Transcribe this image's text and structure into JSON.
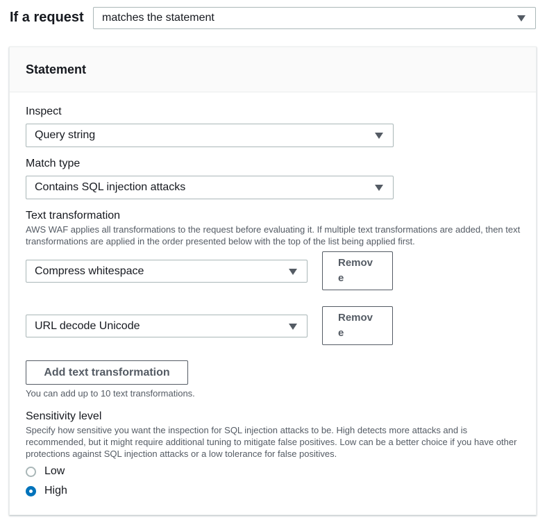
{
  "rule": {
    "if_label": "If a request",
    "condition_value": "matches the statement"
  },
  "statement": {
    "title": "Statement",
    "inspect": {
      "label": "Inspect",
      "value": "Query string"
    },
    "match_type": {
      "label": "Match type",
      "value": "Contains SQL injection attacks"
    },
    "text_transformation": {
      "label": "Text transformation",
      "description": "AWS WAF applies all transformations to the request before evaluating it. If multiple text transformations are added, then text transformations are applied in the order presented below with the top of the list being applied first.",
      "items": [
        {
          "value": "Compress whitespace",
          "remove_label": "Remove"
        },
        {
          "value": "URL decode Unicode",
          "remove_label": "Remove"
        }
      ],
      "add_label": "Add text transformation",
      "hint": "You can add up to 10 text transformations."
    },
    "sensitivity": {
      "label": "Sensitivity level",
      "description": "Specify how sensitive you want the inspection for SQL injection attacks to be. High detects more attacks and is recommended, but it might require additional tuning to mitigate false positives. Low can be a better choice if you have other protections against SQL injection attacks or a low tolerance for false positives.",
      "options": [
        {
          "label": "Low",
          "selected": false
        },
        {
          "label": "High",
          "selected": true
        }
      ]
    }
  },
  "colors": {
    "accent": "#0073bb",
    "border": "#aab7b8",
    "text": "#16191f",
    "secondary_text": "#545b64"
  }
}
